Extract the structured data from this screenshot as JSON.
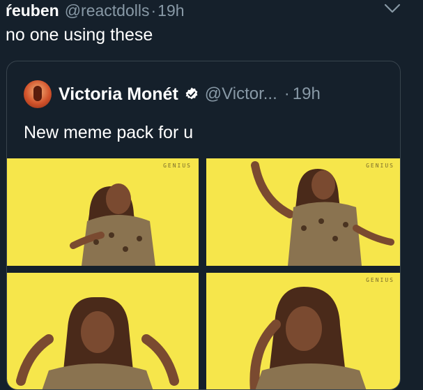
{
  "tweet": {
    "display_name": "ŕeuben",
    "handle": "@reactdolls",
    "separator": "·",
    "time": "19h",
    "text": "no one using these"
  },
  "quote": {
    "display_name": "Victoria Monét",
    "handle": "@Victor...",
    "separator": "·",
    "time": "19h",
    "text": "New meme pack for u"
  },
  "media": {
    "watermark": "GENIUS",
    "tiles": [
      "meme-image-1",
      "meme-image-2",
      "meme-image-3",
      "meme-image-4"
    ]
  },
  "colors": {
    "background": "#15202b",
    "secondary_text": "#8899a6",
    "border": "#38444d",
    "verified": "#ffffff",
    "tile_background": "#f6e64b"
  }
}
